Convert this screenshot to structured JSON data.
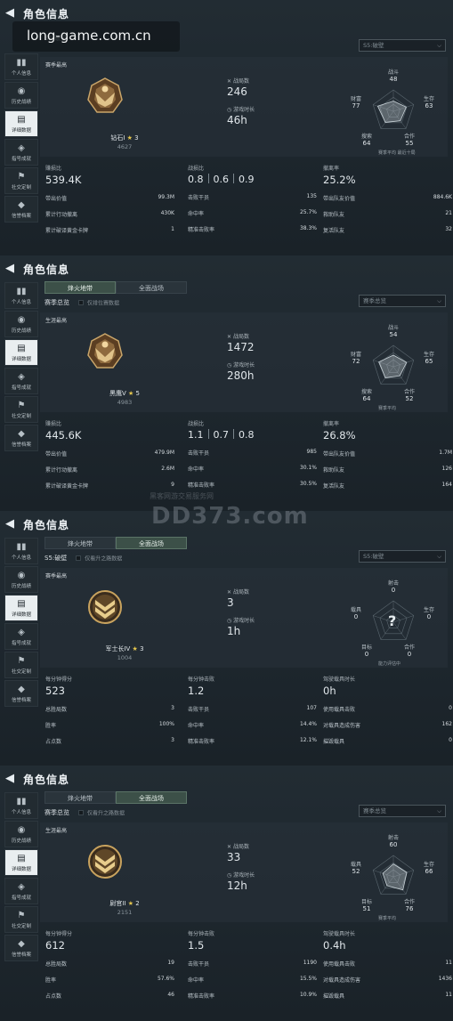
{
  "watermark_top": "long-game.com.cn",
  "watermark_mid": "DD373.com",
  "watermark_mid_sub": "黑客网游交易服务网",
  "panels": [
    {
      "title": "角色信息",
      "status": "",
      "tabs": [],
      "season_label": "S5:破壁",
      "checkbox_label": "",
      "dropdown": "S5:破壁",
      "card_title": "赛季最高",
      "rank_name": "钻石I",
      "rank_stars": "3",
      "rank_score": "4627",
      "mid": [
        {
          "label": "战局数",
          "value": "246"
        },
        {
          "label": "游戏时长",
          "value": "46h"
        }
      ],
      "radar": {
        "top": "战斗",
        "top_v": "48",
        "left": "财富",
        "left_v": "77",
        "right": "生存",
        "right_v": "63",
        "bl": "搜索",
        "bl_v": "64",
        "br": "合作",
        "br_v": "55",
        "legend1": "赛季平均",
        "legend2": "最近十局"
      },
      "stats": [
        {
          "head": "赚损比",
          "head_v": "539.4K",
          "rows": [
            [
              "带出价值",
              "99.3M"
            ],
            [
              "累计行动撤离",
              "430K"
            ],
            [
              "累计破译黄金卡牌",
              "1"
            ]
          ]
        },
        {
          "head": "战损比",
          "head_kd": [
            "0.8",
            "0.6",
            "0.9"
          ],
          "rows": [
            [
              "击败干员",
              "135"
            ],
            [
              "命中率",
              "25.7%"
            ],
            [
              "精准击败率",
              "38.3%"
            ]
          ]
        },
        {
          "head": "撤离率",
          "head_v": "25.2%",
          "rows": [
            [
              "带出队友价值",
              "884.6K"
            ],
            [
              "救助队友",
              "21"
            ],
            [
              "复活队友",
              "32"
            ]
          ]
        }
      ]
    },
    {
      "title": "角色信息",
      "status": "",
      "tabs": [
        "烽火地带",
        "全面战场"
      ],
      "season_label": "赛季总览",
      "checkbox_label": "仅排位赛数据",
      "dropdown": "赛季总览",
      "card_title": "生涯最高",
      "rank_name": "黑鹰V",
      "rank_stars": "5",
      "rank_score": "4983",
      "mid": [
        {
          "label": "战局数",
          "value": "1472"
        },
        {
          "label": "游戏时长",
          "value": "280h"
        }
      ],
      "radar": {
        "top": "战斗",
        "top_v": "54",
        "left": "财富",
        "left_v": "72",
        "right": "生存",
        "right_v": "65",
        "bl": "搜索",
        "bl_v": "64",
        "br": "合作",
        "br_v": "52",
        "legend1": "赛季平均",
        "legend2": ""
      },
      "stats": [
        {
          "head": "赚损比",
          "head_v": "445.6K",
          "rows": [
            [
              "带出价值",
              "479.9M"
            ],
            [
              "累计行动撤离",
              "2.6M"
            ],
            [
              "累计破译黄金卡牌",
              "9"
            ]
          ]
        },
        {
          "head": "战损比",
          "head_kd": [
            "1.1",
            "0.7",
            "0.8"
          ],
          "rows": [
            [
              "击败干员",
              "985"
            ],
            [
              "命中率",
              "30.1%"
            ],
            [
              "精准击败率",
              "30.5%"
            ]
          ]
        },
        {
          "head": "撤离率",
          "head_v": "26.8%",
          "rows": [
            [
              "带出队友价值",
              "1.7M"
            ],
            [
              "救助队友",
              "126"
            ],
            [
              "复活队友",
              "164"
            ]
          ]
        }
      ]
    },
    {
      "title": "角色信息",
      "status": "",
      "tabs": [
        "烽火地带",
        "全面战场"
      ],
      "season_label": "S5:破壁",
      "checkbox_label": "仅看升之路数据",
      "dropdown": "S5:破壁",
      "card_title": "赛季最高",
      "rank_name": "军士长IV",
      "rank_stars": "3",
      "rank_score": "1004",
      "mid": [
        {
          "label": "战局数",
          "value": "3"
        },
        {
          "label": "游戏时长",
          "value": "1h"
        }
      ],
      "radar": {
        "top": "射击",
        "top_v": "0",
        "left": "载具",
        "left_v": "0",
        "right": "生存",
        "right_v": "0",
        "bl": "目标",
        "bl_v": "0",
        "br": "合作",
        "br_v": "0",
        "legend1": "能力评估中",
        "legend2": "",
        "unknown": "?"
      },
      "stats": [
        {
          "head": "每分钟得分",
          "head_v": "523",
          "rows": [
            [
              "总胜局数",
              "3"
            ],
            [
              "胜率",
              "100%"
            ],
            [
              "占点数",
              "3"
            ]
          ]
        },
        {
          "head": "每分钟击败",
          "head_v": "1.2",
          "rows": [
            [
              "击败干员",
              "107"
            ],
            [
              "命中率",
              "14.4%"
            ],
            [
              "精准击败率",
              "12.1%"
            ]
          ]
        },
        {
          "head": "驾驶载具时长",
          "head_v": "0h",
          "rows": [
            [
              "使用载具击败",
              "0"
            ],
            [
              "对载具造成伤害",
              "162"
            ],
            [
              "摧毁载具",
              "0"
            ]
          ]
        }
      ]
    },
    {
      "title": "角色信息",
      "status": "",
      "tabs": [
        "烽火地带",
        "全面战场"
      ],
      "season_label": "赛季总览",
      "checkbox_label": "仅看升之路数据",
      "dropdown": "赛季总览",
      "card_title": "生涯最高",
      "rank_name": "尉官II",
      "rank_stars": "2",
      "rank_score": "2151",
      "mid": [
        {
          "label": "战局数",
          "value": "33"
        },
        {
          "label": "游戏时长",
          "value": "12h"
        }
      ],
      "radar": {
        "top": "射击",
        "top_v": "60",
        "left": "载具",
        "left_v": "52",
        "right": "生存",
        "right_v": "66",
        "bl": "目标",
        "bl_v": "51",
        "br": "合作",
        "br_v": "76",
        "legend1": "赛季平均",
        "legend2": ""
      },
      "stats": [
        {
          "head": "每分钟得分",
          "head_v": "612",
          "rows": [
            [
              "总胜局数",
              "19"
            ],
            [
              "胜率",
              "57.6%"
            ],
            [
              "占点数",
              "46"
            ]
          ]
        },
        {
          "head": "每分钟击败",
          "head_v": "1.5",
          "rows": [
            [
              "击败干员",
              "1190"
            ],
            [
              "命中率",
              "15.5%"
            ],
            [
              "精准击败率",
              "10.9%"
            ]
          ]
        },
        {
          "head": "驾驶载具时长",
          "head_v": "0.4h",
          "rows": [
            [
              "使用载具击败",
              "11"
            ],
            [
              "对载具造成伤害",
              "1436"
            ],
            [
              "摧毁载具",
              "11"
            ]
          ]
        }
      ]
    }
  ],
  "sidebar": [
    "个人信息",
    "历史战绩",
    "详细数据",
    "指号成就",
    "社交定制",
    "信誉档案"
  ],
  "sidebar_active": 2
}
